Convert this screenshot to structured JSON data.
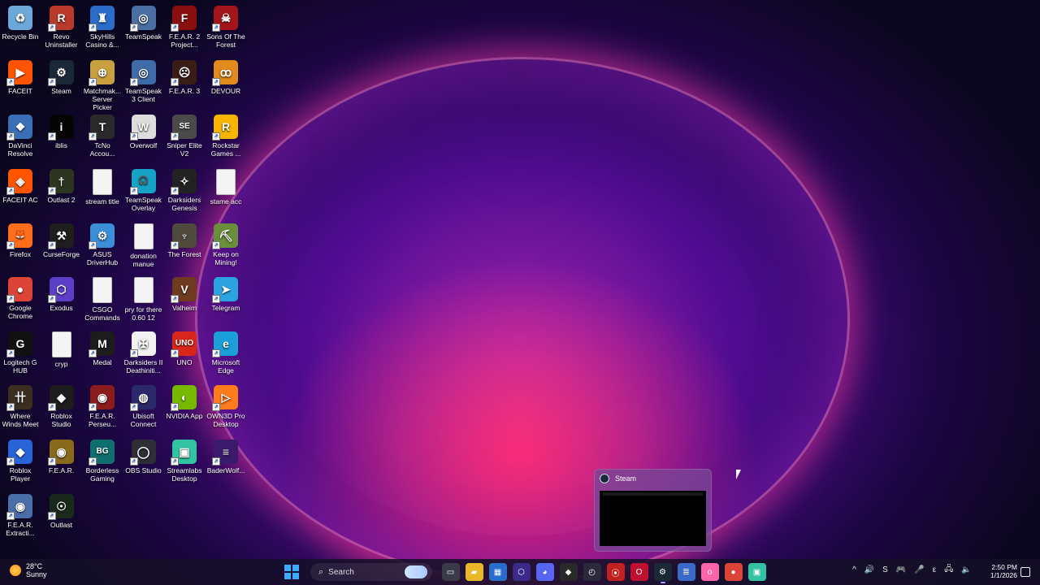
{
  "desktop": {
    "icons": [
      {
        "label": "Recycle Bin",
        "color": "#6da8d8",
        "glyph": "♻"
      },
      {
        "label": "Revo Uninstaller",
        "color": "#b93a2b",
        "glyph": "R"
      },
      {
        "label": "SkyHills Casino &...",
        "color": "#2a6cc9",
        "glyph": "♜"
      },
      {
        "label": "TeamSpeak",
        "color": "#4a6fa5",
        "glyph": "◎"
      },
      {
        "label": "F.E.A.R. 2 Project...",
        "color": "#8a1010",
        "glyph": "F"
      },
      {
        "label": "Sons Of The Forest",
        "color": "#a3151a",
        "glyph": "☠"
      },
      {
        "label": "FACEIT",
        "color": "#ff5500",
        "glyph": "▶"
      },
      {
        "label": "Steam",
        "color": "#1b2838",
        "glyph": "⚙"
      },
      {
        "label": "Matchmak... Server Picker",
        "color": "#c9a040",
        "glyph": "⊕"
      },
      {
        "label": "TeamSpeak 3 Client",
        "color": "#3f6ca8",
        "glyph": "◎"
      },
      {
        "label": "F.E.A.R. 3",
        "color": "#3b1d18",
        "glyph": "☹"
      },
      {
        "label": "DEVOUR",
        "color": "#e28a1b",
        "glyph": "ꝏ"
      },
      {
        "label": "DaVinci Resolve",
        "color": "#3b6fb5",
        "glyph": "❖"
      },
      {
        "label": "iblis",
        "color": "#050505",
        "glyph": "i"
      },
      {
        "label": "TcNo Accou...",
        "color": "#2a2a2a",
        "glyph": "T"
      },
      {
        "label": "Overwolf",
        "color": "#dddddd",
        "glyph": "W"
      },
      {
        "label": "Sniper Elite V2",
        "color": "#4a4a4a",
        "glyph": "SE"
      },
      {
        "label": "Rockstar Games ...",
        "color": "#f7b500",
        "glyph": "R"
      },
      {
        "label": "FACEIT AC",
        "color": "#ff5500",
        "glyph": "◈"
      },
      {
        "label": "Outlast 2",
        "color": "#2c3520",
        "glyph": "†"
      },
      {
        "label": "stream title",
        "color": "#f4f4f4",
        "glyph": "",
        "doc": true
      },
      {
        "label": "TeamSpeak Overlay",
        "color": "#16a3c7",
        "glyph": "🎧"
      },
      {
        "label": "Darksiders Genesis",
        "color": "#222222",
        "glyph": "✧"
      },
      {
        "label": "stame acc",
        "color": "#f4f4f4",
        "glyph": "",
        "doc": true
      },
      {
        "label": "Firefox",
        "color": "#ff6d1a",
        "glyph": "🦊"
      },
      {
        "label": "CurseForge",
        "color": "#1e1e1e",
        "glyph": "⚒"
      },
      {
        "label": "ASUS DriverHub",
        "color": "#3a8fd8",
        "glyph": "⚙"
      },
      {
        "label": "donation manue",
        "color": "#f4f4f4",
        "glyph": "",
        "doc": true
      },
      {
        "label": "The Forest",
        "color": "#4e4a3c",
        "glyph": "♆"
      },
      {
        "label": "Keep on Mining!",
        "color": "#6a8f3a",
        "glyph": "⛏"
      },
      {
        "label": "Google Chrome",
        "color": "#db4437",
        "glyph": "●"
      },
      {
        "label": "Exodus",
        "color": "#5b3fc8",
        "glyph": "⬡"
      },
      {
        "label": "CSGO Commands",
        "color": "#f4f4f4",
        "glyph": "",
        "doc": true
      },
      {
        "label": "pry for there 0.60 12",
        "color": "#f4f4f4",
        "glyph": "",
        "doc": true
      },
      {
        "label": "Valheim",
        "color": "#6e3b1e",
        "glyph": "V"
      },
      {
        "label": "Telegram",
        "color": "#2aa3e0",
        "glyph": "➤"
      },
      {
        "label": "Logitech G HUB",
        "color": "#111111",
        "glyph": "G"
      },
      {
        "label": "cryp",
        "color": "#f4f4f4",
        "glyph": "",
        "doc": true
      },
      {
        "label": "Medal",
        "color": "#1c1c1c",
        "glyph": "M"
      },
      {
        "label": "Darksiders II Deathiniti...",
        "color": "#f2f2f2",
        "glyph": "✠"
      },
      {
        "label": "UNO",
        "color": "#d8261c",
        "glyph": "UNO"
      },
      {
        "label": "Microsoft Edge",
        "color": "#1b9fd8",
        "glyph": "e"
      },
      {
        "label": "Where Winds Meet",
        "color": "#3a2e20",
        "glyph": "卄"
      },
      {
        "label": "Roblox Studio",
        "color": "#1c1c1c",
        "glyph": "◆"
      },
      {
        "label": "F.E.A.R. Perseu...",
        "color": "#8c1c1c",
        "glyph": "◉"
      },
      {
        "label": "Ubisoft Connect",
        "color": "#2a2a6a",
        "glyph": "◍"
      },
      {
        "label": "NVIDIA App",
        "color": "#76b900",
        "glyph": "◐"
      },
      {
        "label": "OWN3D Pro Desktop",
        "color": "#ff7b1c",
        "glyph": "▷"
      },
      {
        "label": "Roblox Player",
        "color": "#2a62d8",
        "glyph": "◆"
      },
      {
        "label": "F.E.A.R.",
        "color": "#8a6a1a",
        "glyph": "◉"
      },
      {
        "label": "Borderless Gaming",
        "color": "#0f6e6e",
        "glyph": "BG"
      },
      {
        "label": "OBS Studio",
        "color": "#2e2e36",
        "glyph": "◯"
      },
      {
        "label": "Streamlabs Desktop",
        "color": "#31c3a2",
        "glyph": "▣"
      },
      {
        "label": "BaderWolf...",
        "color": "#3a1a6a",
        "glyph": "≡"
      },
      {
        "label": "F.E.A.R. Extracti...",
        "color": "#4a6ea8",
        "glyph": "◉"
      },
      {
        "label": "Outlast",
        "color": "#1a2a1a",
        "glyph": "☉"
      }
    ]
  },
  "taskbar": {
    "weather_temp": "28°C",
    "weather_desc": "Sunny",
    "search_label": "Search",
    "apps": [
      {
        "name": "task-view",
        "color": "#3a3a48",
        "glyph": "▭"
      },
      {
        "name": "file-explorer",
        "color": "#e8b828",
        "glyph": "▰"
      },
      {
        "name": "microsoft-store",
        "color": "#2a6cc9",
        "glyph": "▦"
      },
      {
        "name": "exodus",
        "color": "#3a2a8a",
        "glyph": "⬡"
      },
      {
        "name": "discord",
        "color": "#5865f2",
        "glyph": "◕"
      },
      {
        "name": "nvidia",
        "color": "#2a2a2a",
        "glyph": "◆"
      },
      {
        "name": "clock-app",
        "color": "#2a2a3a",
        "glyph": "◴"
      },
      {
        "name": "aim-app",
        "color": "#c02020",
        "glyph": "⦿"
      },
      {
        "name": "opera",
        "color": "#c01030",
        "glyph": "O"
      },
      {
        "name": "steam",
        "color": "#1b2838",
        "glyph": "⚙",
        "active": true
      },
      {
        "name": "notepad",
        "color": "#3a6ac8",
        "glyph": "≣"
      },
      {
        "name": "osu",
        "color": "#ff66aa",
        "glyph": "o"
      },
      {
        "name": "chrome",
        "color": "#db4437",
        "glyph": "●"
      },
      {
        "name": "streamlabs",
        "color": "#31c3a2",
        "glyph": "▣"
      }
    ],
    "tray_icons": [
      "^",
      "🔊",
      "S",
      "🎮",
      "🎤",
      "ε",
      "🖧",
      "🔈"
    ],
    "time": "2:50 PM",
    "date": "1/1/2026"
  },
  "preview": {
    "title": "Steam"
  }
}
